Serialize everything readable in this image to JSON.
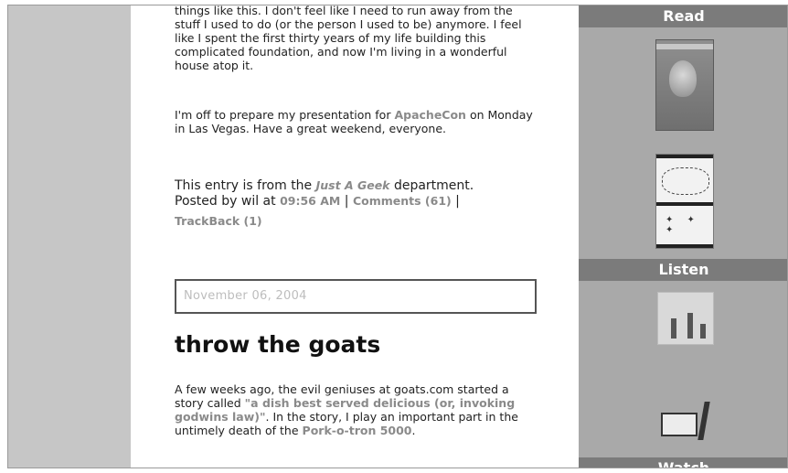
{
  "post_prev": {
    "paragraph_1": "things like this. I don't feel like I need to run away from the stuff I used to do (or the person I used to be) anymore. I feel like I spent the first thirty years of my life building this complicated foundation, and now I'm living in a wonderful house atop it.",
    "paragraph_2_before": "I'm off to prepare my presentation for ",
    "paragraph_2_link": "ApacheCon",
    "paragraph_2_after": " on Monday in Las Vegas. Have a great weekend, everyone.",
    "footer": {
      "entry_prefix": "This entry is from the ",
      "department": "Just A Geek",
      "entry_suffix": " department.",
      "posted_by": "Posted by wil at ",
      "time": "09:56 AM",
      "separator_1": " | ",
      "comments": "Comments (61)",
      "separator_2": " |",
      "trackback": "TrackBack (1)"
    }
  },
  "post_next": {
    "date": "November 06, 2004",
    "title": "throw the goats",
    "paragraph_before": "A few weeks ago, the evil geniuses at goats.com started a story called ",
    "story_link": "\"a dish best served delicious (or, invoking godwins law)\"",
    "paragraph_middle": ". In the story, I play an important part in the untimely death of the ",
    "pork_link": "Pork-o-tron 5000",
    "paragraph_end": "."
  },
  "sidebar": {
    "read_heading": "Read",
    "listen_heading": "Listen",
    "watch_heading": "Watch"
  }
}
